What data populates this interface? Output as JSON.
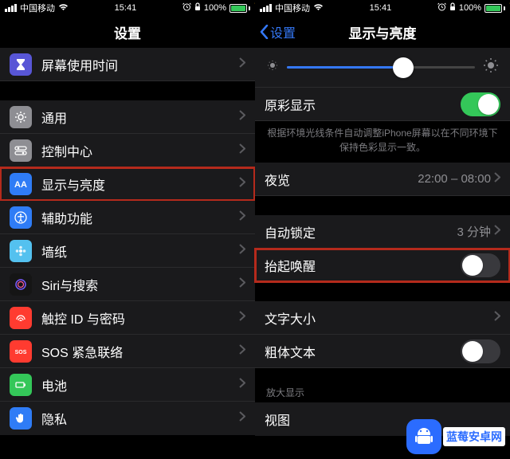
{
  "status": {
    "carrier": "中国移动",
    "time": "15:41",
    "battery_pct": "100%"
  },
  "left": {
    "title": "设置",
    "rows": [
      {
        "label": "屏幕使用时间",
        "icon": "hourglass-icon",
        "bg": "#5856d6"
      },
      {
        "label": "通用",
        "icon": "gear-icon",
        "bg": "#8e8e93"
      },
      {
        "label": "控制中心",
        "icon": "switch-icon",
        "bg": "#8e8e93"
      },
      {
        "label": "显示与亮度",
        "icon": "aa-icon",
        "bg": "#2f7cf6"
      },
      {
        "label": "辅助功能",
        "icon": "accessibility-icon",
        "bg": "#2f7cf6"
      },
      {
        "label": "墙纸",
        "icon": "flower-icon",
        "bg": "#54c1ef"
      },
      {
        "label": "Siri与搜索",
        "icon": "siri-icon",
        "bg": "#151515"
      },
      {
        "label": "触控 ID 与密码",
        "icon": "fingerprint-icon",
        "bg": "#ff3b30"
      },
      {
        "label": "SOS 紧急联络",
        "icon": "sos-icon",
        "bg": "#ff3b30"
      },
      {
        "label": "电池",
        "icon": "battery-icon",
        "bg": "#34c759"
      },
      {
        "label": "隐私",
        "icon": "hand-icon",
        "bg": "#2f7cf6"
      }
    ]
  },
  "right": {
    "back": "设置",
    "title": "显示与亮度",
    "brightness_pct": 62,
    "true_tone": {
      "label": "原彩显示",
      "on": true
    },
    "true_tone_note": "根据环境光线条件自动调整iPhone屏幕以在不同环境下保持色彩显示一致。",
    "night_shift": {
      "label": "夜览",
      "value": "22:00 – 08:00"
    },
    "auto_lock": {
      "label": "自动锁定",
      "value": "3 分钟"
    },
    "raise_to_wake": {
      "label": "抬起唤醒",
      "on": false
    },
    "text_size": {
      "label": "文字大小"
    },
    "bold_text": {
      "label": "粗体文本",
      "on": false
    },
    "zoom_header": "放大显示",
    "view": {
      "label": "视图"
    }
  },
  "watermark": "蓝莓安卓网"
}
